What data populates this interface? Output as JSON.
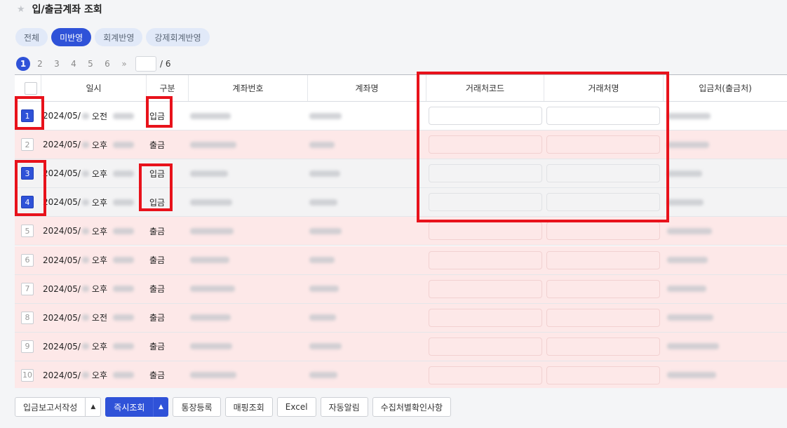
{
  "page": {
    "title": "입/출금계좌 조회"
  },
  "tabs": [
    {
      "label": "전체",
      "active": false
    },
    {
      "label": "미반영",
      "active": true
    },
    {
      "label": "회계반영",
      "active": false
    },
    {
      "label": "강제회계반영",
      "active": false
    }
  ],
  "pager": {
    "pages": [
      "1",
      "2",
      "3",
      "4",
      "5",
      "6"
    ],
    "current": "1",
    "next_symbol": "»",
    "total": "/ 6"
  },
  "table": {
    "headers": {
      "datetime": "일시",
      "type": "구분",
      "account_no": "계좌번호",
      "account_name": "계좌명",
      "partner_code": "거래처코드",
      "partner_name": "거래처명",
      "counterparty": "입금처(출금처)"
    },
    "rows": [
      {
        "num": "1",
        "date": "2024/05/",
        "ampm": "오전",
        "type": "입금",
        "selected": true,
        "tint": "white"
      },
      {
        "num": "2",
        "date": "2024/05/",
        "ampm": "오후",
        "type": "출금",
        "selected": false,
        "tint": "pink"
      },
      {
        "num": "3",
        "date": "2024/05/",
        "ampm": "오후",
        "type": "입금",
        "selected": true,
        "tint": "gray"
      },
      {
        "num": "4",
        "date": "2024/05/",
        "ampm": "오후",
        "type": "입금",
        "selected": true,
        "tint": "gray"
      },
      {
        "num": "5",
        "date": "2024/05/",
        "ampm": "오후",
        "type": "출금",
        "selected": false,
        "tint": "pink"
      },
      {
        "num": "6",
        "date": "2024/05/",
        "ampm": "오후",
        "type": "출금",
        "selected": false,
        "tint": "pink"
      },
      {
        "num": "7",
        "date": "2024/05/",
        "ampm": "오후",
        "type": "출금",
        "selected": false,
        "tint": "pink"
      },
      {
        "num": "8",
        "date": "2024/05/",
        "ampm": "오전",
        "type": "출금",
        "selected": false,
        "tint": "pink"
      },
      {
        "num": "9",
        "date": "2024/05/",
        "ampm": "오후",
        "type": "출금",
        "selected": false,
        "tint": "pink"
      },
      {
        "num": "10",
        "date": "2024/05/",
        "ampm": "오후",
        "type": "출금",
        "selected": false,
        "tint": "pink"
      }
    ]
  },
  "toolbar": {
    "deposit_report": "입금보고서작성",
    "instant_search": "즉시조회",
    "bankbook_register": "통장등록",
    "mapping_search": "매핑조회",
    "excel": "Excel",
    "auto_notify": "자동알림",
    "collector_check": "수집처별확인사항",
    "dropdown_arrow": "▲"
  },
  "colors": {
    "accent": "#2f52d8",
    "highlight": "#e8121b",
    "row_pink": "#fde8e8"
  },
  "icons": {
    "title": "star-icon"
  }
}
